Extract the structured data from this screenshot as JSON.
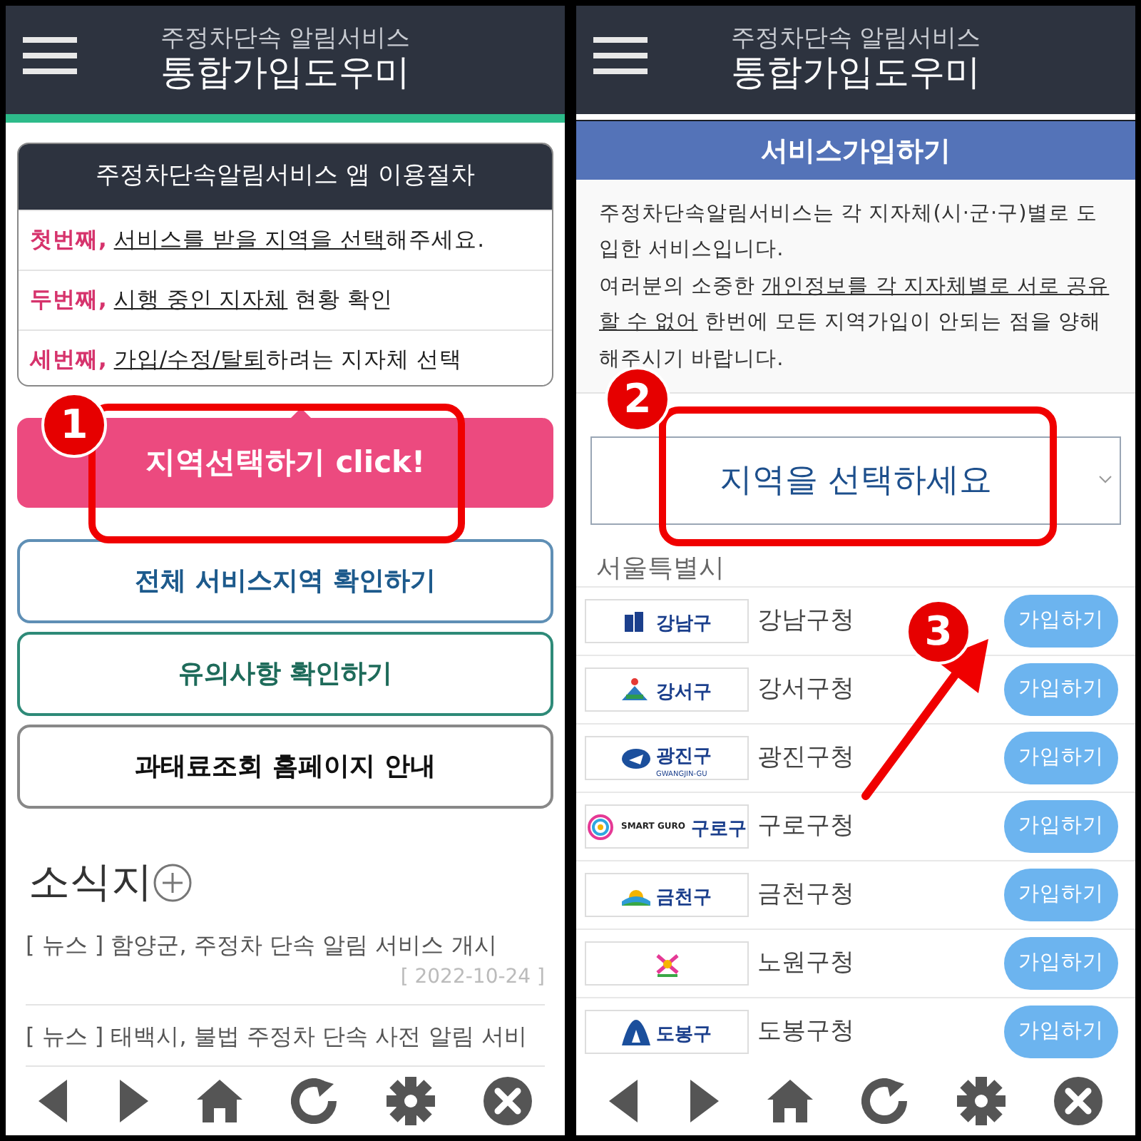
{
  "left_screen": {
    "header": {
      "subtitle": "주정차단속 알림서비스",
      "title": "통합가입도우미"
    },
    "procedure": {
      "title": "주정차단속알림서비스 앱 이용절차",
      "steps": [
        {
          "lead": "첫번째,",
          "underlined": "서비스를 받을 지역을 선택",
          "rest": "해주세요."
        },
        {
          "lead": "두번째,",
          "underlined": "시행 중인 지자체",
          "rest": " 현황 확인"
        },
        {
          "lead": "세번째,",
          "underlined": "가입/수정/탈퇴",
          "rest": "하려는 지자체 선택"
        }
      ]
    },
    "primary_button": "지역선택하기 click!",
    "buttons": [
      {
        "label": "전체 서비스지역 확인하기",
        "kind": "blue"
      },
      {
        "label": "유의사항 확인하기",
        "kind": "green"
      },
      {
        "label": "과태료조회 홈페이지 안내",
        "kind": "gray"
      }
    ],
    "news_title": "소식지",
    "news": [
      {
        "text": "[ 뉴스 ] 함양군, 주정차 단속 알림 서비스 개시",
        "date": "[ 2022-10-24 ]"
      },
      {
        "text": "[ 뉴스 ] 태백시, 불법 주정차 단속 사전 알림 서비"
      }
    ],
    "annotations": [
      {
        "number": "1"
      }
    ]
  },
  "right_screen": {
    "header": {
      "subtitle": "주정차단속 알림서비스",
      "title": "통합가입도우미"
    },
    "section_title": "서비스가입하기",
    "intro": [
      "주정차단속알림서비스는 각 지자체(시·군·구)별로 도입한 서비스입니다.",
      {
        "before": "여러분의 소중한 ",
        "underlined": "개인정보를 각 지자체별로 서로 공유할 수 없어",
        "after": " 한번에 모든 지역가입이 안되는 점을 양해해주시기 바랍니다."
      }
    ],
    "region_select": {
      "placeholder": "지역을 선택하세요"
    },
    "region_group": "서울특별시",
    "districts": [
      {
        "logo_text": "강남구",
        "kind": "gangnam",
        "name": "강남구청",
        "button": "가입하기"
      },
      {
        "logo_text": "강서구",
        "kind": "gangseo",
        "name": "강서구청",
        "button": "가입하기"
      },
      {
        "logo_text": "광진구",
        "logo_sub": "GWANGJIN-GU",
        "kind": "gwangjin",
        "name": "광진구청",
        "button": "가입하기"
      },
      {
        "logo_text": "구로구",
        "logo_brand": "SMART GURO",
        "kind": "guro",
        "name": "구로구청",
        "button": "가입하기"
      },
      {
        "logo_text": "금천구",
        "kind": "geumcheon",
        "name": "금천구청",
        "button": "가입하기"
      },
      {
        "kind": "nowon",
        "name": "노원구청",
        "button": "가입하기"
      },
      {
        "logo_text": "도봉구",
        "kind": "dobong",
        "name": "도봉구청",
        "button": "가입하기"
      }
    ],
    "annotations": [
      {
        "number": "2"
      },
      {
        "number": "3"
      }
    ]
  }
}
